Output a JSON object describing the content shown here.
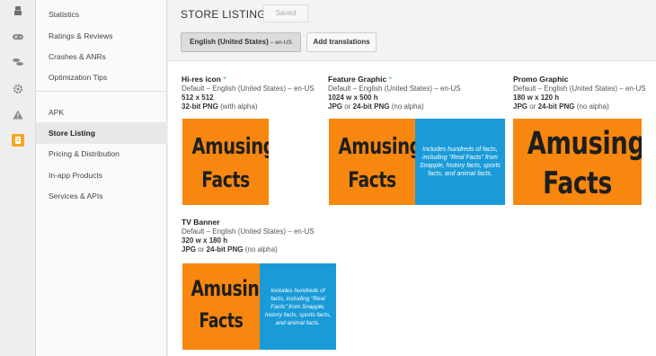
{
  "rail": {
    "icons": [
      "android-icon",
      "gamepad-icon",
      "coins-icon",
      "gear-icon",
      "alert-icon",
      "promo-icon"
    ]
  },
  "nav": {
    "items_top": [
      "Statistics",
      "Ratings & Reviews",
      "Crashes & ANRs",
      "Optimization Tips"
    ],
    "items_bottom": [
      "APK",
      "Store Listing",
      "Pricing & Distribution",
      "In-app Products",
      "Services & APIs"
    ],
    "selected": "Store Listing"
  },
  "header": {
    "title": "STORE LISTING",
    "saved_label": "Saved",
    "language_label": "English (United States)",
    "language_code": "– en-US",
    "add_translations_label": "Add translations"
  },
  "assets": {
    "hires": {
      "title": "Hi-res icon",
      "required": "*",
      "locale": "Default – English (United States) – en-US",
      "size": "512 x 512",
      "format_bold": "32-bit PNG",
      "format_rest": " (with alpha)"
    },
    "feature": {
      "title": "Feature Graphic",
      "required": "*",
      "locale": "Default – English (United States) – en-US",
      "size": "1024 w x 500 h",
      "format_a": "JPG",
      "format_or": " or ",
      "format_bold": "24-bit PNG",
      "format_rest": " (no alpha)"
    },
    "promo": {
      "title": "Promo Graphic",
      "locale": "Default – English (United States) – en-US",
      "size": "180 w x 120 h",
      "format_a": "JPG",
      "format_or": " or ",
      "format_bold": "24-bit PNG",
      "format_rest": " (no alpha)"
    },
    "tv": {
      "title": "TV Banner",
      "locale": "Default – English (United States) – en-US",
      "size": "320 w x 180 h",
      "format_a": "JPG",
      "format_or": " or ",
      "format_bold": "24-bit PNG",
      "format_rest": " (no alpha)"
    }
  },
  "artwork": {
    "word1": "Amusing",
    "word2": "Facts",
    "tagline": "Includes hundreds of facts, including \"Real Facts\" from Snapple, history facts, sports facts, and animal facts.",
    "orange": "#f7870f",
    "blue": "#1a9bd7"
  },
  "colors": {
    "accent": "#3aa0d8",
    "rail_active": "#f5a623",
    "android": "#7a7a7a"
  }
}
